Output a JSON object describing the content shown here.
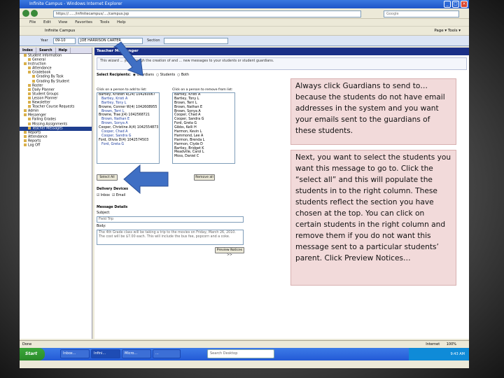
{
  "window": {
    "title": "Infinite Campus - Windows Internet Explorer",
    "url": "https://....../infinitecampus/..../campus.jsp",
    "search_placeholder": "Google",
    "menu": [
      "File",
      "Edit",
      "View",
      "Favorites",
      "Tools",
      "Help"
    ],
    "fav_tab": "Infinite Campus",
    "toolbar_right": "Page ▾  Tools ▾"
  },
  "app": {
    "year_label": "Year",
    "year_value": "09-10",
    "school_value": "JOE HARRISON CARTER",
    "section_label": "Section",
    "tabs": [
      "Index",
      "Search",
      "Help"
    ],
    "tree": [
      "Student Information",
      "General",
      "Instruction",
      "Attendance",
      "Gradebook",
      "Grading By Task",
      "Grading By Student",
      "Roster",
      "Daily Planner",
      "Student Groups",
      "Lesson Planner",
      "Newsletter",
      "Teacher Course Requests",
      "Admin",
      "Messenger",
      "Failing Grades",
      "Missing Assignments",
      "Teacher Messages",
      "Reports",
      "Attendance",
      "Reports",
      "Log Off"
    ],
    "main_header": "Teacher Messenger",
    "intro_text": "This wizard ... you through the creation of and ... new messages to your students or student guardians.",
    "recipients_label": "Select Recipients:",
    "recipient_options": [
      "Guardians",
      "Students",
      "Both"
    ],
    "left_list_caption": "Click on a person to add to list:",
    "right_list_caption": "Click on a person to remove from list:",
    "left_list": [
      {
        "t": "Bartley, Kristen R(24) 104260067",
        "s": false
      },
      {
        "t": "Bartley, Kristi A",
        "s": true
      },
      {
        "t": "Bartley, Tony L",
        "s": true
      },
      {
        "t": "Browne, Conner W(4) 1042608955",
        "s": false
      },
      {
        "t": "Brown, Terri L",
        "s": true
      },
      {
        "t": "Browne, Trae J(4) 1042568721",
        "s": false
      },
      {
        "t": "Brown, Nathan E",
        "s": true
      },
      {
        "t": "Brown, Sonya A",
        "s": true
      },
      {
        "t": "Cooper, Christine A(4) 1042554873",
        "s": false
      },
      {
        "t": "Cooper, Chad A",
        "s": true
      },
      {
        "t": "Cooper, Sandra G",
        "s": true
      },
      {
        "t": "Ford, Olivia D(4) 1042574503",
        "s": false
      },
      {
        "t": "Ford, Greta G",
        "s": true
      }
    ],
    "right_list": [
      "Bartley, Kristi A",
      "Bartley, Tony L",
      "Brown, Terri L",
      "Brown, Nathan E",
      "Brown, Sonya A",
      "Cooper, Chad A",
      "Cooper, Sandra G",
      "Ford, Greta G",
      "Gibbs, Kelli H",
      "Harmon, Kevin L",
      "Hammond, Lee A",
      "Harmon, Brenda L",
      "Harmon, Clyde D",
      "Bartley, Bridget K",
      "Meadville, Carol L",
      "Moss, Daniel C"
    ],
    "select_all": "Select All",
    "remove_all": "Remove all",
    "delivery_label": "Delivery Devices",
    "delivery_inbox": "Inbox",
    "delivery_email": "Email",
    "details_label": "Message Details",
    "subject_label": "Subject:",
    "subject_value": "Field Trip",
    "body_label": "Body:",
    "body_value": "The 4th Grade class will be taking a trip to the movies on Friday, March 26, 2010. The cost will be $7.00 each. This will include the bus fee, popcorn and a coke.",
    "preview_button": "Preview Notices >>",
    "status_left": "Done",
    "status_zone": "Internet",
    "status_zoom": "100%"
  },
  "taskbar": {
    "start": "Start",
    "tasks": [
      "Inbox...",
      "Infini...",
      "Micro...",
      "...",
      "Search Desktop"
    ],
    "clock": "9:43 AM"
  },
  "callouts": {
    "first": "Always click Guardians to send to…because the students do not have email addresses in the system and you want your emails sent to the guardians of these students.",
    "second": "Next, you want to select the students you want this message to go to.  Click the “select all” and this will populate the students in to the right column.  These students reflect the section you have chosen at the top.  You can click on certain students in the right column and remove them if you do not want this message sent to a particular students’ parent.  Click Preview Notices…"
  },
  "colors": {
    "callout_bg": "#f2dada",
    "arrow_fill": "#3f6fc4",
    "header_blue": "#1a2f87"
  }
}
